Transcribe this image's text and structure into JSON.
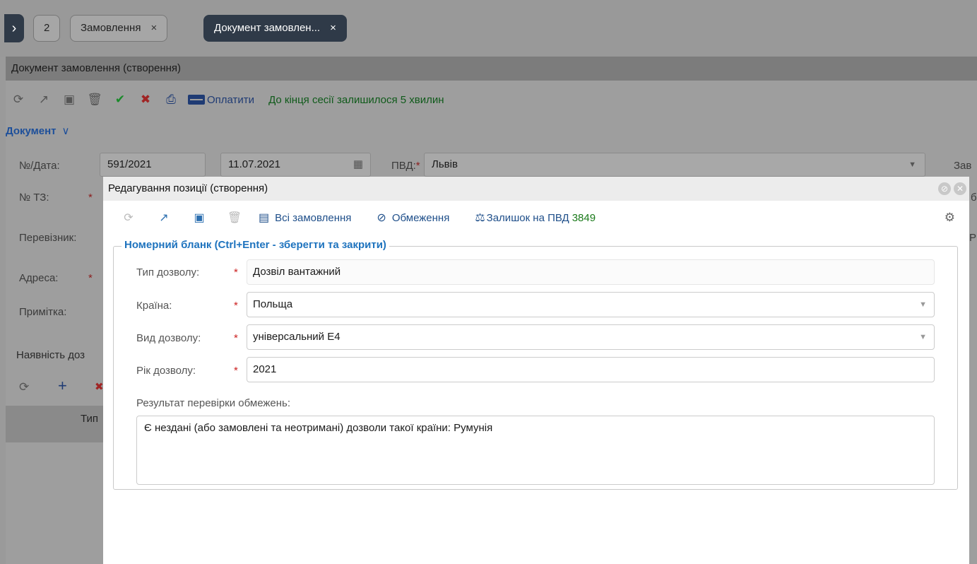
{
  "tabs": {
    "nav_toggle": "›",
    "counter": "2",
    "orders_tab": "Замовлення",
    "doc_tab": "Документ замовлен...",
    "close": "×"
  },
  "page": {
    "title": "Документ замовлення (створення)",
    "pay_label": "Оплатити",
    "session_text": "До кінця сесії залишилося 5 хвилин",
    "section_label": "Документ",
    "section_chevron": "∨"
  },
  "form": {
    "num_date_label": "№/Дата:",
    "num_value": "591/2021",
    "date_value": "11.07.2021",
    "pvd_label": "ПВД:",
    "pvd_value": "Львів",
    "za_label": "Зав",
    "tz_label": "№ ТЗ:",
    "carrier_label": "Перевізник:",
    "address_label": "Адреса:",
    "note_label": "Примітка:",
    "presence_label": "Наявність доз",
    "grid_col": "Тип",
    "right_cut_1": "б",
    "right_cut_2": "Р",
    "req": "*"
  },
  "modal": {
    "title": "Редагування позиції (створення)",
    "all_orders": "Всі замовлення",
    "limits": "Обмеження",
    "balance_label": "Залишок на ПВД",
    "balance_value": "3849",
    "legend": "Номерний бланк (Ctrl+Enter - зберегти та закрити)",
    "fields": [
      {
        "label": "Тип дозволу:",
        "value": "Дозвіл вантажний"
      },
      {
        "label": "Країна:",
        "value": "Польща"
      },
      {
        "label": "Вид дозволу:",
        "value": "універсальний Е4"
      },
      {
        "label": "Рік дозволу:",
        "value": "2021"
      }
    ],
    "result_label": "Результат перевірки обмежень:",
    "result_text": "Є нездані (або замовлені та неотримані) дозволи такої країни: Румунія"
  }
}
